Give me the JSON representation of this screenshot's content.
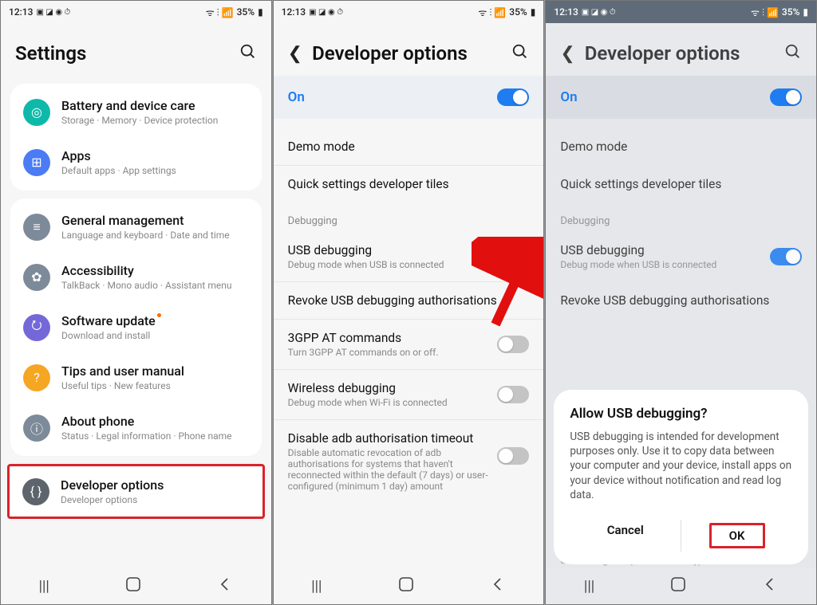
{
  "status": {
    "time": "12:13",
    "battery": "35%",
    "signal_text": "ᯤ ᯤ ▮▮▯"
  },
  "screen1": {
    "title": "Settings",
    "items": [
      {
        "label": "Battery and device care",
        "sub": "Storage  ·  Memory  ·  Device protection",
        "icon_bg": "ic-teal",
        "glyph": "◎"
      },
      {
        "label": "Apps",
        "sub": "Default apps  ·  App settings",
        "icon_bg": "ic-blue",
        "glyph": "◫"
      },
      {
        "label": "General management",
        "sub": "Language and keyboard  ·  Date and time",
        "icon_bg": "ic-gray",
        "glyph": "≡"
      },
      {
        "label": "Accessibility",
        "sub": "TalkBack  ·  Mono audio  ·  Assistant menu",
        "icon_bg": "ic-gray",
        "glyph": "✿"
      },
      {
        "label": "Software update",
        "sub": "Download and install",
        "icon_bg": "ic-purple",
        "glyph": "⭮",
        "badge": true
      },
      {
        "label": "Tips and user manual",
        "sub": "Useful tips  ·  New features",
        "icon_bg": "ic-orange",
        "glyph": "?"
      },
      {
        "label": "About phone",
        "sub": "Status  ·  Legal information  ·  Phone name",
        "icon_bg": "ic-gray",
        "glyph": "ⓘ"
      },
      {
        "label": "Developer options",
        "sub": "Developer options",
        "icon_bg": "ic-dark",
        "glyph": "{ }",
        "highlighted": true
      }
    ]
  },
  "screen2": {
    "title": "Developer options",
    "on_label": "On",
    "on_state": true,
    "rows": [
      {
        "label": "Demo mode",
        "sub": ""
      },
      {
        "label": "Quick settings developer tiles",
        "sub": ""
      }
    ],
    "debug_header": "Debugging",
    "debug_rows": [
      {
        "label": "USB debugging",
        "sub": "Debug mode when USB is connected",
        "toggle": false
      },
      {
        "label": "Revoke USB debugging authorisations",
        "sub": ""
      },
      {
        "label": "3GPP AT commands",
        "sub": "Turn 3GPP AT commands on or off.",
        "toggle": false
      },
      {
        "label": "Wireless debugging",
        "sub": "Debug mode when Wi-Fi is connected",
        "toggle": false
      },
      {
        "label": "Disable adb authorisation timeout",
        "sub": "Disable automatic revocation of adb authorisations for systems that haven't reconnected within the default (7 days) or user-configured (minimum 1 day) amount",
        "toggle": false
      }
    ]
  },
  "screen3": {
    "title": "Developer options",
    "on_label": "On",
    "on_state": true,
    "rows": [
      {
        "label": "Demo mode",
        "sub": ""
      },
      {
        "label": "Quick settings developer tiles",
        "sub": ""
      }
    ],
    "debug_header": "Debugging",
    "debug_rows": [
      {
        "label": "USB debugging",
        "sub": "Debug mode when USB is connected",
        "toggle": true
      },
      {
        "label": "Revoke USB debugging authorisations",
        "sub": ""
      }
    ],
    "bottom_text": "user-configured (minimum 1 day) amount",
    "dialog": {
      "title": "Allow USB debugging?",
      "body": "USB debugging is intended for development purposes only. Use it to copy data between your computer and your device, install apps on your device without notification and read log data.",
      "cancel": "Cancel",
      "ok": "OK"
    }
  },
  "nav": {
    "recents": "|||",
    "home": "☐",
    "back": "⟨"
  }
}
